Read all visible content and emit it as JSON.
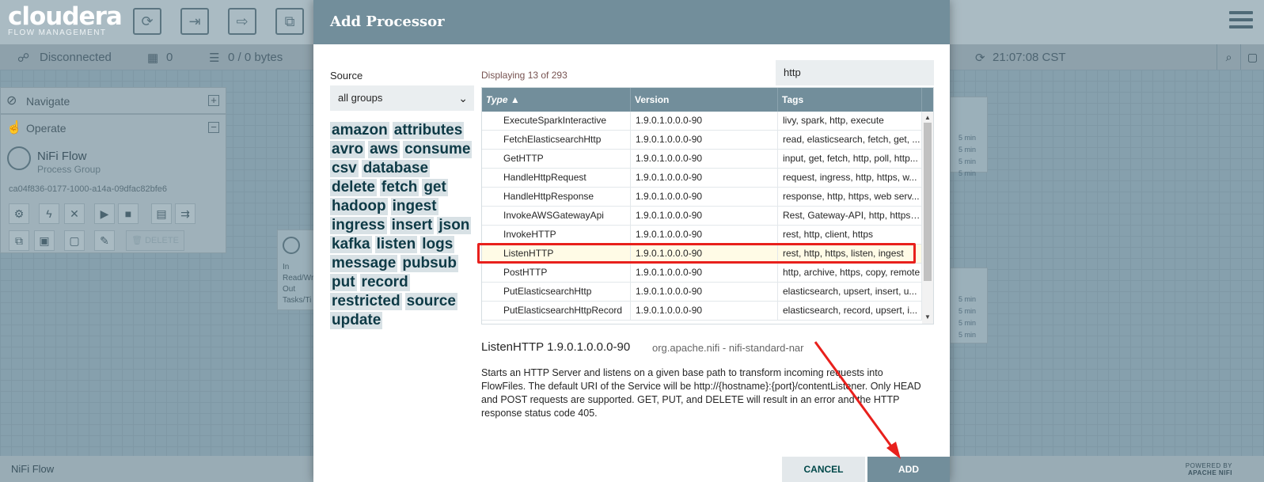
{
  "app": {
    "brand": "cloudera",
    "brand_sub": "FLOW MANAGEMENT"
  },
  "status_bar": {
    "connection": "Disconnected",
    "active_threads": "0",
    "queued": "0 / 0 bytes",
    "time": "21:07:08 CST"
  },
  "navigate_panel": {
    "title": "Navigate"
  },
  "operate_panel": {
    "title": "Operate",
    "group_name": "NiFi Flow",
    "group_type": "Process Group",
    "group_id": "ca04f836-0177-1000-a14a-09dfac82bfe6",
    "delete_label": "DELETE"
  },
  "bg_processor": {
    "labels": [
      "In",
      "Read/Wr",
      "Out",
      "Tasks/Ti"
    ]
  },
  "bg_minutes": [
    "5 min",
    "5 min",
    "5 min",
    "5 min"
  ],
  "footer": {
    "breadcrumb": "NiFi Flow",
    "powered_by": "POWERED BY",
    "powered_name": "APACHE NIFI"
  },
  "modal": {
    "title": "Add Processor",
    "source_label": "Source",
    "source_value": "all groups",
    "displaying": "Displaying 13 of 293",
    "filter_value": "http",
    "columns": {
      "type": "Type",
      "version": "Version",
      "tags": "Tags"
    },
    "tags": [
      "amazon",
      "attributes",
      "avro",
      "aws",
      "consume",
      "csv",
      "database",
      "delete",
      "fetch",
      "get",
      "hadoop",
      "ingest",
      "ingress",
      "insert",
      "json",
      "kafka",
      "listen",
      "logs",
      "message",
      "pubsub",
      "put",
      "record",
      "restricted",
      "source",
      "update"
    ],
    "rows": [
      {
        "type": "ExecuteSparkInteractive",
        "version": "1.9.0.1.0.0.0-90",
        "tags": "livy, spark, http, execute"
      },
      {
        "type": "FetchElasticsearchHttp",
        "version": "1.9.0.1.0.0.0-90",
        "tags": "read, elasticsearch, fetch, get, ..."
      },
      {
        "type": "GetHTTP",
        "version": "1.9.0.1.0.0.0-90",
        "tags": "input, get, fetch, http, poll, http..."
      },
      {
        "type": "HandleHttpRequest",
        "version": "1.9.0.1.0.0.0-90",
        "tags": "request, ingress, http, https, w..."
      },
      {
        "type": "HandleHttpResponse",
        "version": "1.9.0.1.0.0.0-90",
        "tags": "response, http, https, web serv..."
      },
      {
        "type": "InvokeAWSGatewayApi",
        "version": "1.9.0.1.0.0.0-90",
        "tags": "Rest, Gateway-API, http, https, ..."
      },
      {
        "type": "InvokeHTTP",
        "version": "1.9.0.1.0.0.0-90",
        "tags": "rest, http, client, https"
      },
      {
        "type": "ListenHTTP",
        "version": "1.9.0.1.0.0.0-90",
        "tags": "rest, http, https, listen, ingest"
      },
      {
        "type": "PostHTTP",
        "version": "1.9.0.1.0.0.0-90",
        "tags": "http, archive, https, copy, remote"
      },
      {
        "type": "PutElasticsearchHttp",
        "version": "1.9.0.1.0.0.0-90",
        "tags": "elasticsearch, upsert, insert, u..."
      },
      {
        "type": "PutElasticsearchHttpRecord",
        "version": "1.9.0.1.0.0.0-90",
        "tags": "elasticsearch, record, upsert, i..."
      }
    ],
    "selected_index": 7,
    "description_title": "ListenHTTP 1.9.0.1.0.0.0-90",
    "description_bundle": "org.apache.nifi - nifi-standard-nar",
    "description_text": "Starts an HTTP Server and listens on a given base path to transform incoming requests into FlowFiles. The default URI of the Service will be http://{hostname}:{port}/contentListener. Only HEAD and POST requests are supported. GET, PUT, and DELETE will result in an error and the HTTP response status code 405.",
    "cancel_label": "CANCEL",
    "add_label": "ADD"
  },
  "colors": {
    "header": "#728e9b",
    "highlight": "#e8201c",
    "tag_bg": "#d8e1e5",
    "tag_text": "#0e3a46"
  }
}
